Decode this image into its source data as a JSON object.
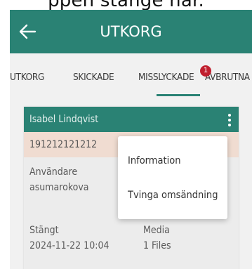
{
  "caption": "ppen stänge här.",
  "appbar": {
    "title": "UTKORG"
  },
  "tabs": [
    {
      "label": "UTKORG"
    },
    {
      "label": "SKICKADE"
    },
    {
      "label": "MISSLYCKADE",
      "badge": "1"
    },
    {
      "label": "AVBRUTNA"
    }
  ],
  "card": {
    "name": "Isabel Lindqvist",
    "id": "191212121212",
    "user_label": "Användare",
    "user_value": "asumarokova",
    "closed_label": "Stängt",
    "closed_value": "2024-11-22 10:04",
    "media_label": "Media",
    "media_value": "1 Files"
  },
  "menu": {
    "items": [
      {
        "label": "Information"
      },
      {
        "label": "Tvinga omsändning"
      }
    ]
  },
  "colors": {
    "primary": "#2a8274",
    "badge": "#c0202f",
    "id_row": "#f0dcd1"
  }
}
